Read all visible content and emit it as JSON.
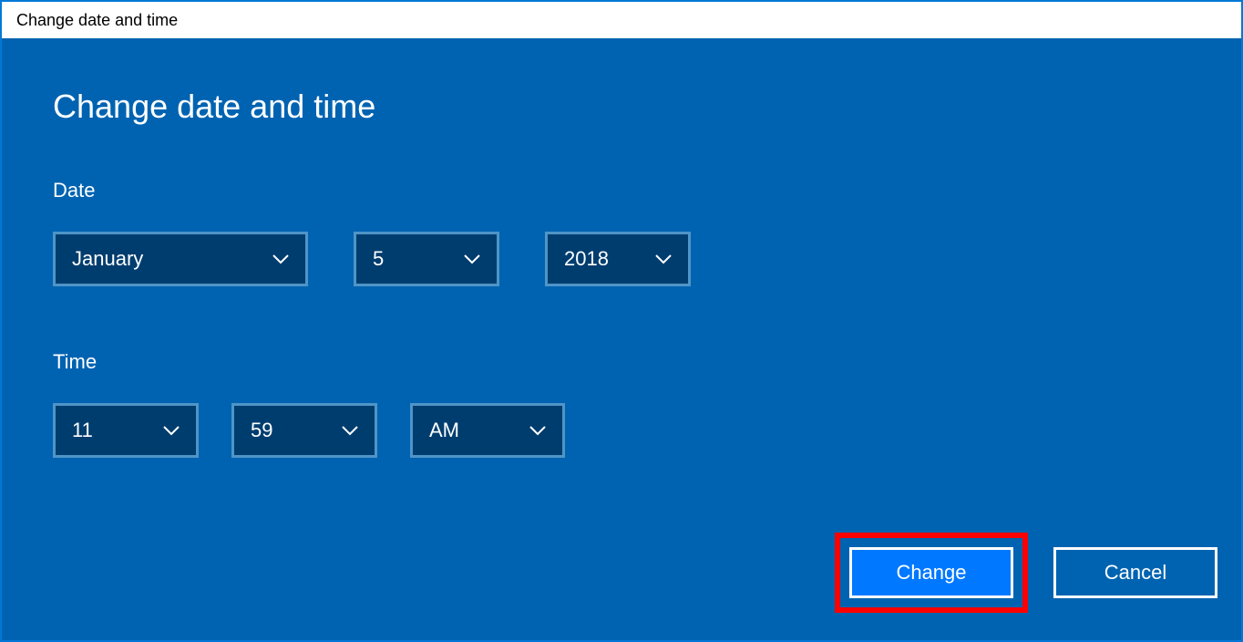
{
  "titlebar": {
    "title": "Change date and time"
  },
  "heading": "Change date and time",
  "labels": {
    "date": "Date",
    "time": "Time"
  },
  "date": {
    "month": "January",
    "day": "5",
    "year": "2018"
  },
  "time": {
    "hour": "11",
    "minute": "59",
    "ampm": "AM"
  },
  "buttons": {
    "change": "Change",
    "cancel": "Cancel"
  }
}
